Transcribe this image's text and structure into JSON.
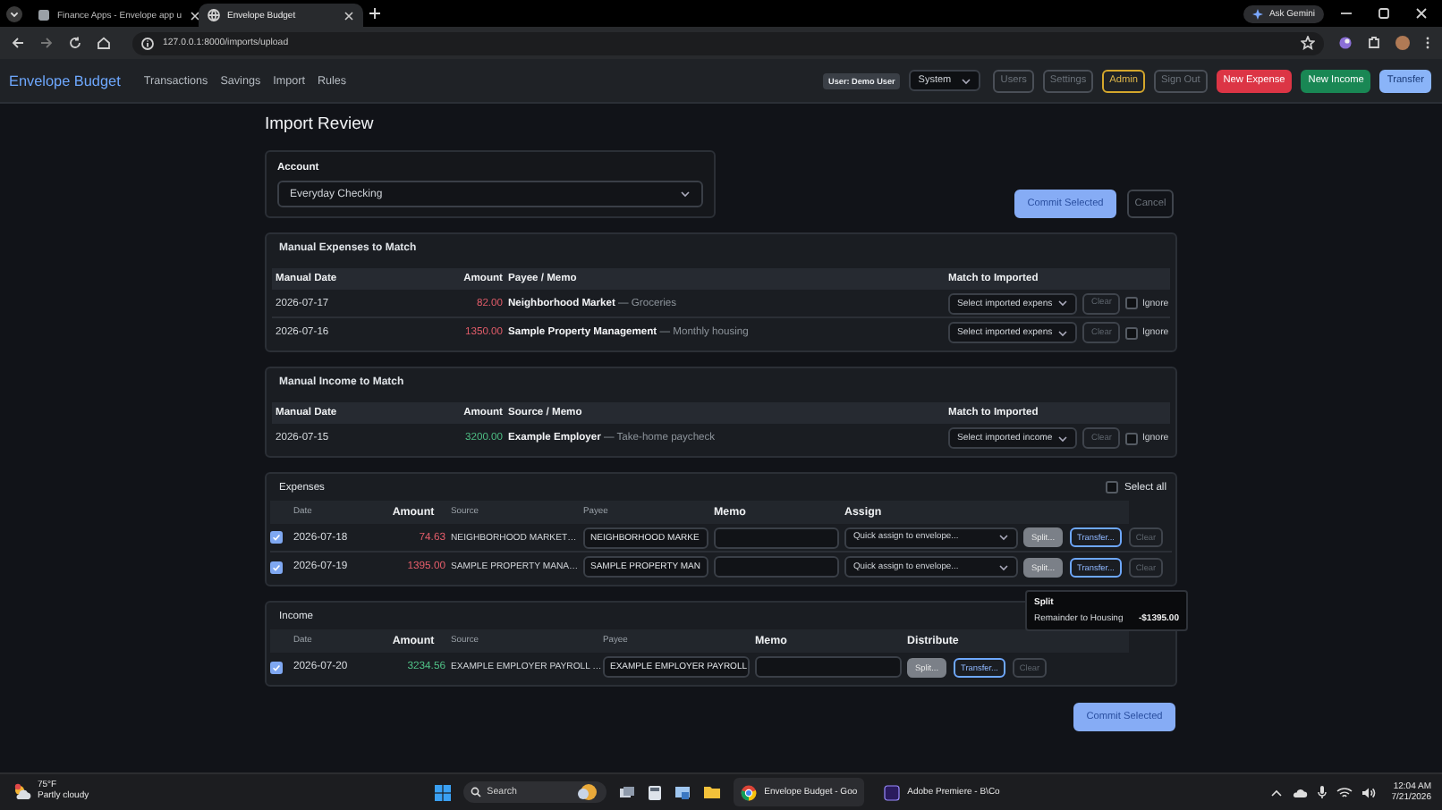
{
  "browser": {
    "tabs": [
      {
        "title": "Finance Apps - Envelope app u",
        "selected": false
      },
      {
        "title": "Envelope Budget",
        "selected": true
      }
    ],
    "ask_button": "Ask Gemini",
    "url": "127.0.0.1:8000/imports/upload"
  },
  "navbar": {
    "brand": "Envelope Budget",
    "links": [
      "Transactions",
      "Savings",
      "Import",
      "Rules"
    ],
    "user_badge": "User: Demo User",
    "theme": "System",
    "buttons": [
      {
        "label": "Users",
        "kind": "muted"
      },
      {
        "label": "Settings",
        "kind": "muted"
      },
      {
        "label": "Admin",
        "kind": "warning"
      },
      {
        "label": "Sign Out",
        "kind": "muted"
      },
      {
        "label": "New Expense",
        "kind": "danger"
      },
      {
        "label": "New Income",
        "kind": "success"
      },
      {
        "label": "Transfer",
        "kind": "primary"
      }
    ]
  },
  "title": "Import Review",
  "account": {
    "label": "Account",
    "value": "Everyday Checking"
  },
  "commit_top": "Commit Selected",
  "cancel": "Cancel",
  "manual_expenses": {
    "title": "Manual Expenses to Match",
    "kind": "expense",
    "columns": [
      "Manual Date",
      "Amount",
      "Payee / Memo",
      "Match to Imported"
    ],
    "rows": [
      {
        "date": "2026-07-17",
        "amount": "82.00",
        "payee_memo": "**Neighborhood Market** — Groceries",
        "match_placeholder": "Select imported expens",
        "clear": "Clear",
        "ignore": {
          "label": "Ignore",
          "checked": false
        }
      },
      {
        "date": "2026-07-16",
        "amount": "1350.00",
        "payee_memo": "**Sample Property Management** — Monthly housing",
        "match_placeholder": "Select imported expens",
        "clear": "Clear",
        "ignore": {
          "label": "Ignore",
          "checked": false
        }
      }
    ]
  },
  "manual_income": {
    "title": "Manual Income to Match",
    "kind": "income",
    "columns": [
      "Manual Date",
      "Amount",
      "Source / Memo",
      "Match to Imported"
    ],
    "rows": [
      {
        "date": "2026-07-15",
        "amount": "3200.00",
        "payee_memo": "**Example Employer** — Take-home paycheck",
        "match_placeholder": "Select imported income",
        "clear": "Clear",
        "ignore": {
          "label": "Ignore",
          "checked": false
        }
      }
    ]
  },
  "expenses": {
    "title": "Expenses",
    "kind": "expense",
    "select_all": {
      "label": "Select all",
      "checked": false
    },
    "columns": [
      {
        "label": "Date",
        "bold": false
      },
      {
        "label": "Amount",
        "bold": true
      },
      {
        "label": "Source",
        "bold": false
      },
      {
        "label": "Payee",
        "bold": false
      },
      {
        "label": "Memo",
        "bold": true
      },
      {
        "label": "Assign",
        "bold": true
      }
    ],
    "rows": [
      {
        "checked": true,
        "date": "2026-07-18",
        "amount": "74.63",
        "source": "NEIGHBORHOOD MARKET…",
        "payee": "NEIGHBORHOOD MARKE",
        "assign_placeholder": "Quick assign to envelope...",
        "actions": [
          {
            "label": "Split...",
            "kind": "split"
          },
          {
            "label": "Transfer...",
            "kind": "transfer"
          },
          {
            "label": "Clear",
            "kind": "clear"
          }
        ]
      },
      {
        "checked": true,
        "date": "2026-07-19",
        "amount": "1395.00",
        "source": "SAMPLE PROPERTY MANA…",
        "payee": "SAMPLE PROPERTY MAN",
        "assign_placeholder": "Quick assign to envelope...",
        "actions": [
          {
            "label": "Split...",
            "kind": "split"
          },
          {
            "label": "Transfer...",
            "kind": "transfer"
          },
          {
            "label": "Clear",
            "kind": "clear"
          }
        ],
        "tooltip": {
          "title": "Split",
          "label": "Remainder to Housing",
          "amount": "-$1395.00"
        }
      }
    ]
  },
  "income": {
    "title": "Income",
    "kind": "income",
    "columns": [
      {
        "label": "Date",
        "bold": false
      },
      {
        "label": "Amount",
        "bold": true
      },
      {
        "label": "Source",
        "bold": false
      },
      {
        "label": "Payee",
        "bold": false
      },
      {
        "label": "Memo",
        "bold": true
      },
      {
        "label": "Distribute",
        "bold": true
      }
    ],
    "rows": [
      {
        "checked": true,
        "date": "2026-07-20",
        "amount": "3234.56",
        "source": "EXAMPLE EMPLOYER PAYROLL …",
        "payee": "EXAMPLE EMPLOYER PAYROLL",
        "actions": [
          {
            "label": "Split...",
            "kind": "split"
          },
          {
            "label": "Transfer...",
            "kind": "transfer"
          },
          {
            "label": "Clear",
            "kind": "clear"
          }
        ]
      }
    ]
  },
  "commit_bottom": "Commit Selected",
  "taskbar": {
    "weather": {
      "temp": "75°F",
      "condition": "Partly cloudy"
    },
    "search": "Search",
    "apps": [
      {
        "label": "Envelope Budget - Goo",
        "kind": "chrome"
      },
      {
        "label": "Adobe Premiere - B\\Co",
        "kind": "premiere"
      }
    ],
    "time": "12:04 AM",
    "date": "7/21/2026"
  }
}
